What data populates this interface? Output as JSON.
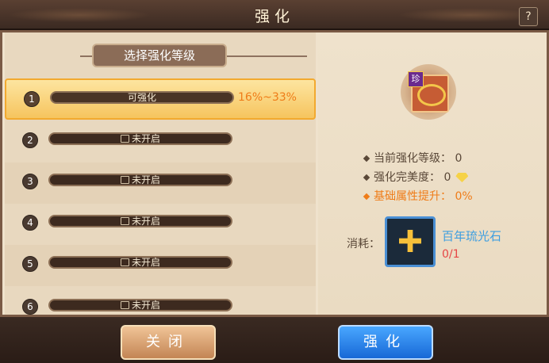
{
  "window": {
    "title": "强化",
    "help_label": "?"
  },
  "level_panel": {
    "section_title": "选择强化等级",
    "rows": [
      {
        "number": "1",
        "status": "可强化",
        "range": "16%~33%",
        "selected": true,
        "locked": false
      },
      {
        "number": "2",
        "status": "未开启",
        "range": "",
        "selected": false,
        "locked": true
      },
      {
        "number": "3",
        "status": "未开启",
        "range": "",
        "selected": false,
        "locked": true
      },
      {
        "number": "4",
        "status": "未开启",
        "range": "",
        "selected": false,
        "locked": true
      },
      {
        "number": "5",
        "status": "未开启",
        "range": "",
        "selected": false,
        "locked": true
      },
      {
        "number": "6",
        "status": "未开启",
        "range": "",
        "selected": false,
        "locked": true
      }
    ]
  },
  "item": {
    "tag": "珍",
    "icon": "ornament-icon"
  },
  "stats": {
    "current_level_label": "当前强化等级：",
    "current_level_value": "0",
    "perfection_label": "强化完美度：",
    "perfection_value": "0",
    "base_boost_label": "基础属性提升：",
    "base_boost_value": "0%"
  },
  "cost": {
    "label": "消耗：",
    "material_name": "百年琉光石",
    "material_count": "0/1"
  },
  "buttons": {
    "close_label": "关闭",
    "strengthen_label": "强化"
  },
  "colors": {
    "accent_orange": "#ef7c18",
    "material_blue": "#3e9ee0",
    "count_red": "#e64545"
  }
}
